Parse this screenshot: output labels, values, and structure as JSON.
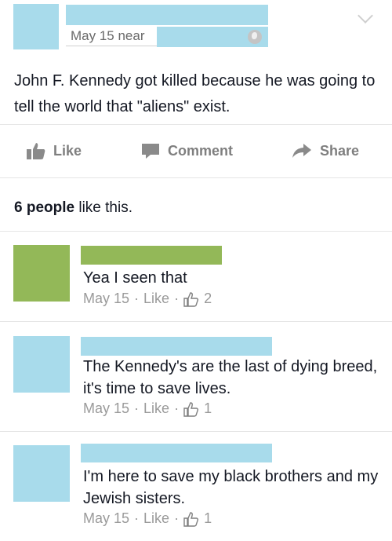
{
  "post": {
    "timestamp": "May 15 near",
    "text": "John F. Kennedy got killed because he was going to tell the world that \"aliens\" exist.",
    "icons": {
      "privacy": "globe-icon",
      "options": "chevron-down-icon"
    }
  },
  "actions": {
    "like_label": "Like",
    "comment_label": "Comment",
    "share_label": "Share"
  },
  "likes_summary": {
    "count_text": "6 people",
    "suffix": " like this."
  },
  "comments": [
    {
      "text": "Yea I seen that",
      "date": "May 15",
      "separator": "·",
      "like_label": "Like",
      "like_count": "2",
      "avatar_color": "#93b858"
    },
    {
      "text": "The Kennedy's are the last of dying breed, it's time to save lives.",
      "date": "May 15",
      "separator": "·",
      "like_label": "Like",
      "like_count": "1",
      "avatar_color": "#a8dbeb"
    },
    {
      "text": "I'm here to save my black brothers and my Jewish sisters.",
      "date": "May 15",
      "separator": "·",
      "like_label": "Like",
      "like_count": "1",
      "avatar_color": "#a8dbeb"
    }
  ],
  "colors": {
    "redaction_blue": "#a8dbeb",
    "redaction_green": "#93b858",
    "meta_gray": "#9a9a9a"
  }
}
